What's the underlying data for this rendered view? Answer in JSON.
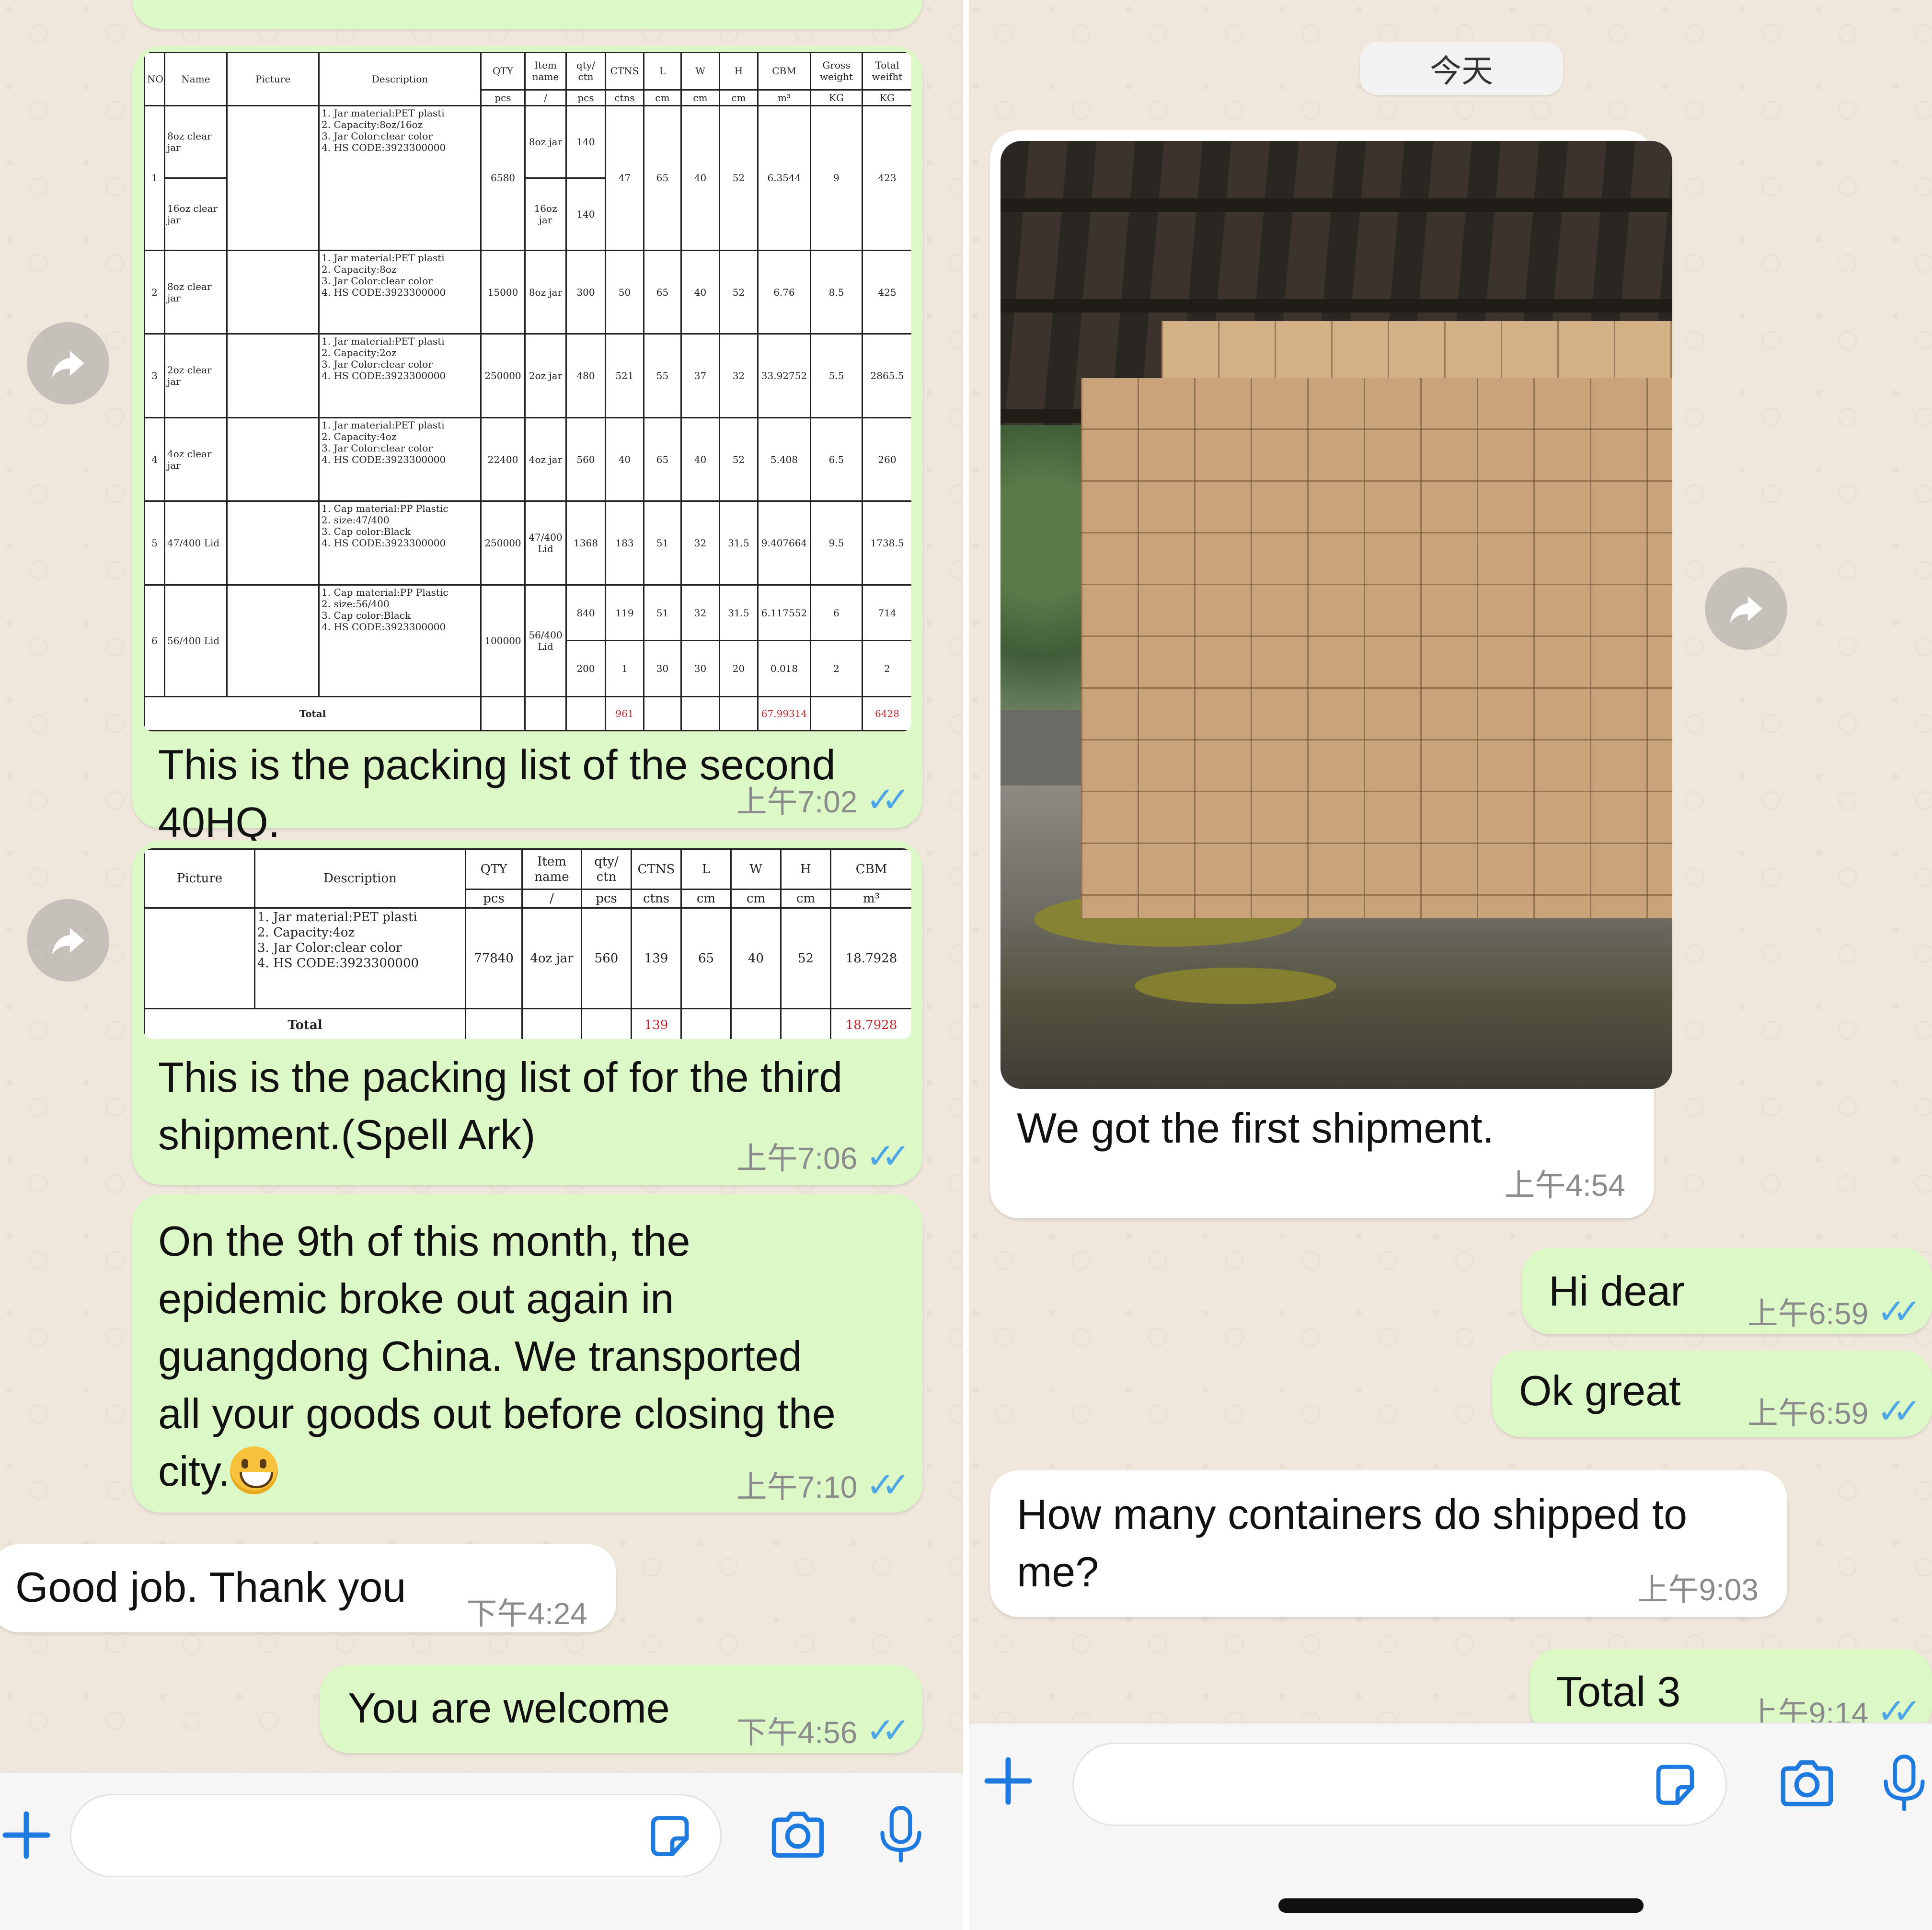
{
  "left_chat": {
    "messages": [
      {
        "id": "m1",
        "direction": "out",
        "type": "image",
        "caption": "This is the packing list of the second 40HQ.",
        "time": "上午7:02",
        "status": "read"
      },
      {
        "id": "m2",
        "direction": "out",
        "type": "image",
        "caption": "This is the packing list of for the third shipment.(Spell Ark)",
        "time": "上午7:06",
        "status": "read"
      },
      {
        "id": "m3",
        "direction": "out",
        "type": "text",
        "text_lines": [
          "On the 9th of this month, the",
          "epidemic broke out again in",
          "guangdong China. We transported",
          "all your goods out before closing the",
          "city."
        ],
        "emoji": "grinning-face",
        "time": "上午7:10",
        "status": "read"
      },
      {
        "id": "m4",
        "direction": "in",
        "type": "text",
        "text": "Good job. Thank you",
        "time": "下午4:24"
      },
      {
        "id": "m5",
        "direction": "out",
        "type": "text",
        "text": "You are welcome",
        "time": "下午4:56",
        "status": "read"
      }
    ]
  },
  "right_chat": {
    "date_divider": "今天",
    "messages": [
      {
        "id": "r1",
        "direction": "in",
        "type": "image",
        "caption": "We got the first shipment.",
        "time": "上午4:54"
      },
      {
        "id": "r2",
        "direction": "out",
        "type": "text",
        "text": "Hi dear",
        "time": "上午6:59",
        "status": "read"
      },
      {
        "id": "r3",
        "direction": "out",
        "type": "text",
        "text": "Ok great",
        "time": "上午6:59",
        "status": "read"
      },
      {
        "id": "r4",
        "direction": "in",
        "type": "text",
        "text_lines": [
          "How many containers do shipped to",
          "me?"
        ],
        "time": "上午9:03"
      },
      {
        "id": "r5",
        "direction": "out",
        "type": "text",
        "text": "Total 3",
        "time": "上午9:14",
        "status": "read"
      }
    ]
  },
  "packing_list_1": {
    "headers": [
      "NO.",
      "Name",
      "Picture",
      "Description",
      "QTY",
      "Item name",
      "qty/ ctn",
      "CTNS",
      "L",
      "W",
      "H",
      "CBM",
      "Gross weight",
      "Total weifht"
    ],
    "units": [
      "pcs",
      "/",
      "pcs",
      "ctns",
      "cm",
      "cm",
      "cm",
      "m³",
      "KG",
      "KG"
    ],
    "rows": [
      {
        "no": "1",
        "names": [
          "8oz clear jar",
          "16oz clear jar"
        ],
        "desc": "1. Jar material:PET plasti\n2. Capacity:8oz/16oz\n3. Jar Color:clear color\n4. HS CODE:3923300000",
        "qty": "6580",
        "items": [
          "8oz jar",
          "16oz jar"
        ],
        "per_ctn": [
          "140",
          "140"
        ],
        "ctns": "47",
        "l": "65",
        "w": "40",
        "h": "52",
        "cbm": "6.3544",
        "gross": "9",
        "total": "423"
      },
      {
        "no": "2",
        "names": [
          "8oz clear jar"
        ],
        "desc": "1. Jar material:PET plasti\n2. Capacity:8oz\n3. Jar Color:clear color\n4. HS CODE:3923300000",
        "qty": "15000",
        "items": [
          "8oz jar"
        ],
        "per_ctn": [
          "300"
        ],
        "ctns": "50",
        "l": "65",
        "w": "40",
        "h": "52",
        "cbm": "6.76",
        "gross": "8.5",
        "total": "425"
      },
      {
        "no": "3",
        "names": [
          "2oz clear jar"
        ],
        "desc": "1. Jar material:PET plasti\n2. Capacity:2oz\n3. Jar Color:clear color\n4. HS CODE:3923300000",
        "qty": "250000",
        "items": [
          "2oz jar"
        ],
        "per_ctn": [
          "480"
        ],
        "ctns": "521",
        "l": "55",
        "w": "37",
        "h": "32",
        "cbm": "33.92752",
        "gross": "5.5",
        "total": "2865.5"
      },
      {
        "no": "4",
        "names": [
          "4oz clear jar"
        ],
        "desc": "1. Jar material:PET plasti\n2. Capacity:4oz\n3. Jar Color:clear color\n4. HS CODE:3923300000",
        "qty": "22400",
        "items": [
          "4oz jar"
        ],
        "per_ctn": [
          "560"
        ],
        "ctns": "40",
        "l": "65",
        "w": "40",
        "h": "52",
        "cbm": "5.408",
        "gross": "6.5",
        "total": "260"
      },
      {
        "no": "5",
        "names": [
          "47/400 Lid"
        ],
        "desc": "1. Cap material:PP Plastic\n2. size:47/400\n3. Cap color:Black\n4. HS CODE:3923300000",
        "qty": "250000",
        "items": [
          "47/400 Lid"
        ],
        "per_ctn": [
          "1368"
        ],
        "ctns": "183",
        "l": "51",
        "w": "32",
        "h": "31.5",
        "cbm": "9.407664",
        "gross": "9.5",
        "total": "1738.5"
      },
      {
        "no": "6",
        "names": [
          "56/400 Lid"
        ],
        "desc": "1. Cap material:PP Plastic\n2. size:56/400\n3. Cap color:Black\n4. HS CODE:3923300000",
        "qty": "100000",
        "items": [
          "56/400 Lid"
        ],
        "sub": [
          {
            "per_ctn": "840",
            "ctns": "119",
            "l": "51",
            "w": "32",
            "h": "31.5",
            "cbm": "6.117552",
            "gross": "6",
            "total": "714"
          },
          {
            "per_ctn": "200",
            "ctns": "1",
            "l": "30",
            "w": "30",
            "h": "20",
            "cbm": "0.018",
            "gross": "2",
            "total": "2"
          }
        ]
      }
    ],
    "total": {
      "label": "Total",
      "ctns": "961",
      "cbm": "67.99314",
      "total": "6428"
    }
  },
  "packing_list_2": {
    "headers": [
      "Picture",
      "Description",
      "QTY",
      "Item name",
      "qty/ ctn",
      "CTNS",
      "L",
      "W",
      "H",
      "CBM"
    ],
    "units": [
      "pcs",
      "/",
      "pcs",
      "ctns",
      "cm",
      "cm",
      "cm",
      "m³"
    ],
    "row": {
      "desc": "1. Jar material:PET plasti\n2. Capacity:4oz\n3. Jar Color:clear color\n4. HS CODE:3923300000",
      "qty": "77840",
      "item": "4oz jar",
      "per_ctn": "560",
      "ctns": "139",
      "l": "65",
      "w": "40",
      "h": "52",
      "cbm": "18.7928"
    },
    "total": {
      "label": "Total",
      "ctns": "139",
      "cbm": "18.7928"
    }
  },
  "colors": {
    "outgoing_bubble": "#dbf8c6",
    "incoming_bubble": "#ffffff",
    "chat_bg": "#efe7dc",
    "read_ticks": "#4fa6e6",
    "accent": "#1f7ae0"
  },
  "icons": [
    "forward-icon",
    "plus-icon",
    "sticker-icon",
    "camera-icon",
    "microphone-icon",
    "double-check-icon"
  ]
}
